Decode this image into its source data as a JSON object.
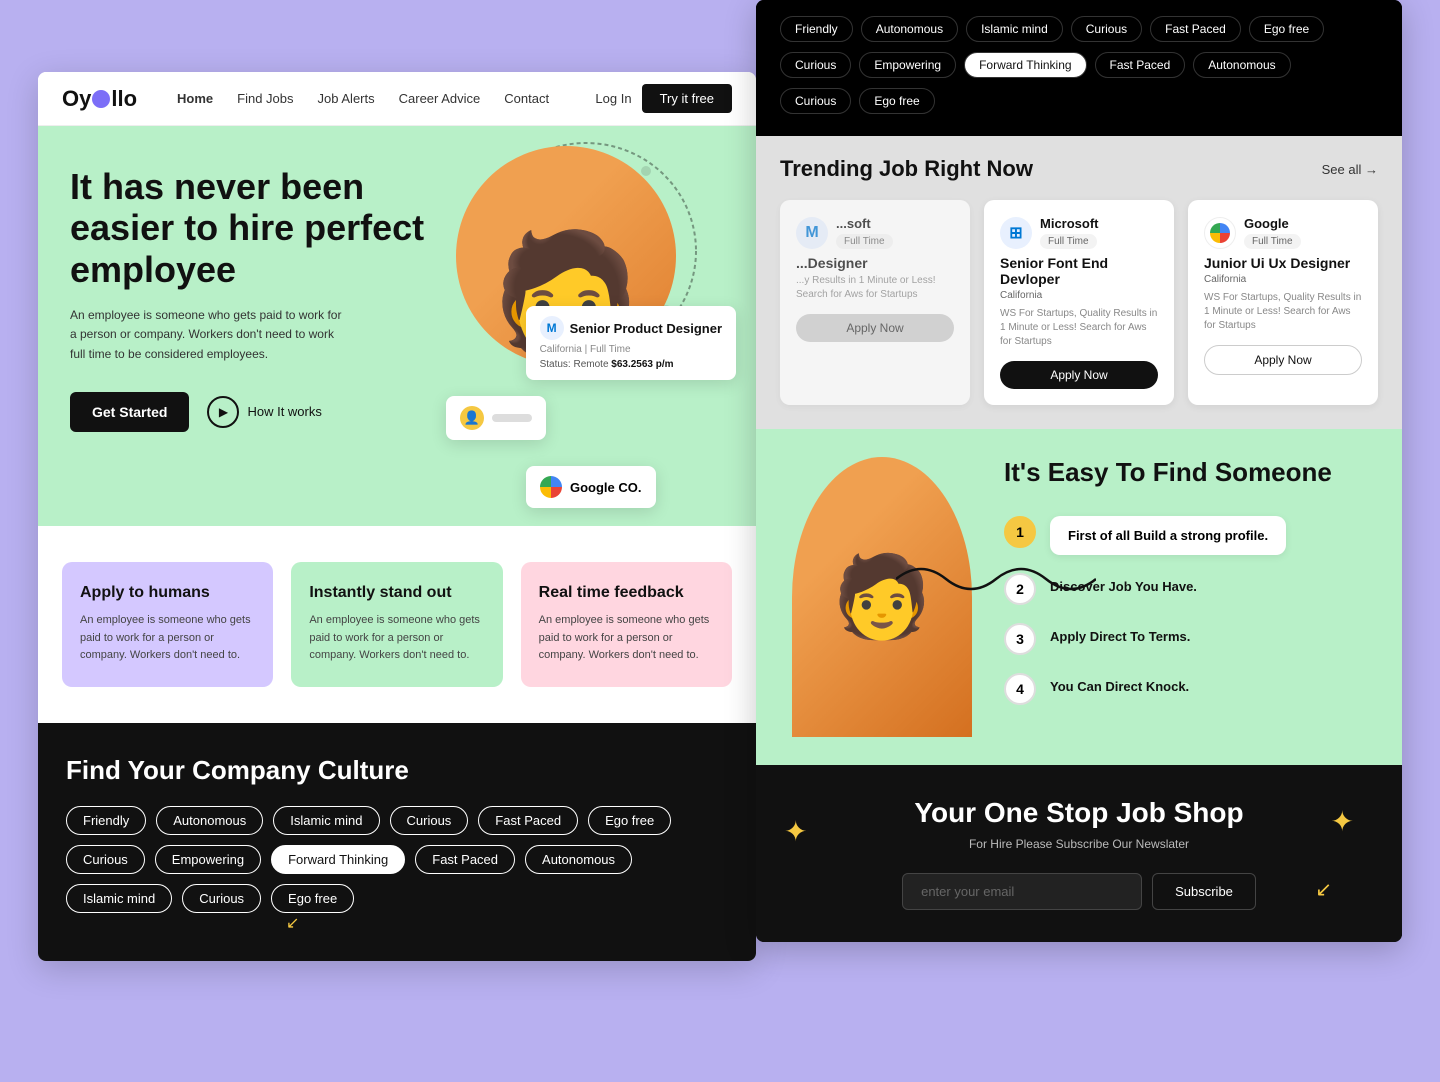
{
  "body_bg": "#b8b0f0",
  "left_panel": {
    "navbar": {
      "logo": "Oy  llo",
      "links": [
        "Home",
        "Find Jobs",
        "Job Alerts",
        "Career Advice",
        "Contact"
      ],
      "active_link": "Home",
      "login_label": "Log In",
      "try_label": "Try it free"
    },
    "hero": {
      "title": "It has never been easier to hire perfect employee",
      "description": "An employee is someone who gets paid to work for a person or company. Workers don't need to work full time to be considered employees.",
      "btn_get_started": "Get Started",
      "btn_how": "How It works",
      "job_card_1": {
        "title": "Senior Product Designer",
        "location": "California",
        "type": "Full Time",
        "status": "Remote",
        "salary": "$63.2563 p/m"
      },
      "google_card": "Google CO."
    },
    "features": [
      {
        "id": "apply-humans",
        "title": "Apply to humans",
        "desc": "An employee is someone who gets paid to work for a person or company. Workers don't need to.",
        "color": "purple"
      },
      {
        "id": "stand-out",
        "title": "Instantly stand out",
        "desc": "An employee is someone who gets paid to work for a person or company. Workers don't need to.",
        "color": "green"
      },
      {
        "id": "real-feedback",
        "title": "Real time feedback",
        "desc": "An employee is someone who gets paid to work for a person or company. Workers don't need to.",
        "color": "pink"
      }
    ],
    "culture": {
      "title": "Find Your Company Culture",
      "rows": [
        [
          "Friendly",
          "Autonomous",
          "Islamic mind",
          "Curious",
          "Fast Paced",
          "Ego free"
        ],
        [
          "Curious",
          "Empowering",
          "Forward Thinking",
          "Fast Paced",
          "Autonomous"
        ],
        [
          "Islamic mind",
          "Curious",
          "Ego free"
        ]
      ],
      "selected_tag": "Forward Thinking"
    }
  },
  "right_panel": {
    "dark_tags": {
      "rows": [
        [
          "Friendly",
          "Autonomous",
          "Islamic mind",
          "Curious",
          "Fast Paced",
          "Ego free"
        ],
        [
          "Curious",
          "Empowering",
          "Forward Thinking",
          "Fast Paced",
          "Autonomous"
        ],
        [
          "Curious",
          "Ego free"
        ]
      ],
      "selected": "Forward Thinking"
    },
    "trending": {
      "title": "g Job Right Now",
      "see_all": "See all →",
      "jobs": [
        {
          "company": "Microsoft",
          "type": "Full Time",
          "title": "Senior Font End Devloper",
          "location": "California",
          "desc": "WS For Startups, Quality Results in 1 Minute or Less! Search for Aws for Startups",
          "btn": "Apply Now",
          "btn_style": "dark"
        },
        {
          "company": "Google",
          "type": "Full Time",
          "title": "Junior Ui Ux Designer",
          "location": "California",
          "desc": "WS For Startups, Quality Results in 1 Minute or Less! Search for Aws for Startups",
          "btn": "Apply Now",
          "btn_style": "outline"
        }
      ]
    },
    "easy": {
      "title": "It's Easy To Find Someone",
      "steps": [
        {
          "num": "1",
          "label": "First of all Build a strong profile.",
          "active": true,
          "card": true
        },
        {
          "num": "2",
          "label": "Discover Job You Have.",
          "active": false
        },
        {
          "num": "3",
          "label": "Apply Direct To Terms.",
          "active": false
        },
        {
          "num": "4",
          "label": "You Can Direct Knock.",
          "active": false
        }
      ]
    },
    "shop": {
      "title": "Your One Stop Job Shop",
      "subtitle": "For Hire Please Subscribe Our Newslater",
      "placeholder": "enter your email",
      "btn_subscribe": "Subscribe"
    }
  },
  "icons": {
    "play": "▶",
    "arrow_right": "→",
    "star": "✦",
    "cursor": "↙"
  }
}
